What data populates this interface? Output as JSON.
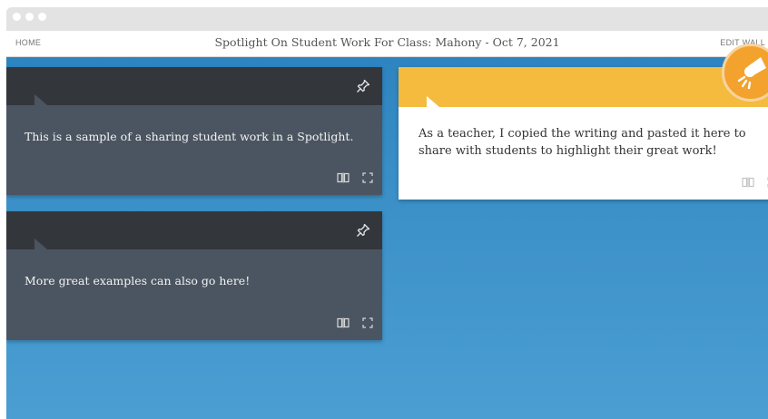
{
  "nav": {
    "home_label": "HOME",
    "title": "Spotlight On Student Work For Class: Mahony - Oct 7, 2021",
    "edit_label": "EDIT WALL"
  },
  "cards": [
    {
      "text": "This is a sample of a sharing student work in a Spotlight.",
      "header_color": "#33373c",
      "body_color": "#4b5561"
    },
    {
      "text": "More great examples can also go here!",
      "header_color": "#33373c",
      "body_color": "#4b5561"
    },
    {
      "text": "As a teacher, I copied the writing and pasted it here to share with students to highlight their great work!",
      "header_color": "#f5bb3f",
      "body_color": "#ffffff"
    }
  ],
  "icons": {
    "pin": "pin-icon",
    "open_book": "book-icon",
    "expand": "expand-icon",
    "spotlight": "spotlight-icon"
  },
  "colors": {
    "wall_top": "#2d84bf",
    "wall_bottom": "#4a9ed2",
    "accent": "#f3a22d"
  }
}
